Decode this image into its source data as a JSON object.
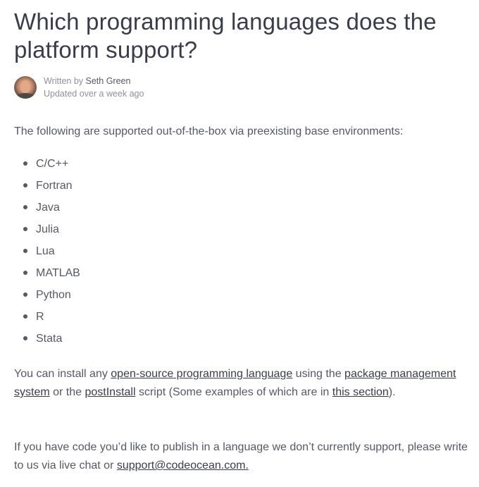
{
  "article": {
    "title": "Which programming languages does the platform support?",
    "written_by_prefix": "Written by ",
    "author": "Seth Green",
    "updated": "Updated over a week ago",
    "intro": "The following are supported out-of-the-box via preexisting base environments:",
    "languages": [
      "C/C++",
      "Fortran",
      "Java",
      "Julia",
      "Lua",
      "MATLAB",
      "Python",
      "R",
      "Stata"
    ],
    "install": {
      "prefix": " You can install any ",
      "link1": "open-source programming language",
      "mid1": " using the ",
      "link2": "package management system",
      "mid2": " or the ",
      "link3": "postInstall",
      "mid3": " script (Some examples of which are in ",
      "link4": "this section",
      "suffix": ")."
    },
    "contact": {
      "text": "If you have code you’d like to publish in a language we don’t currently support, please write to us via live chat or ",
      "email": "support@codeocean.com."
    }
  }
}
